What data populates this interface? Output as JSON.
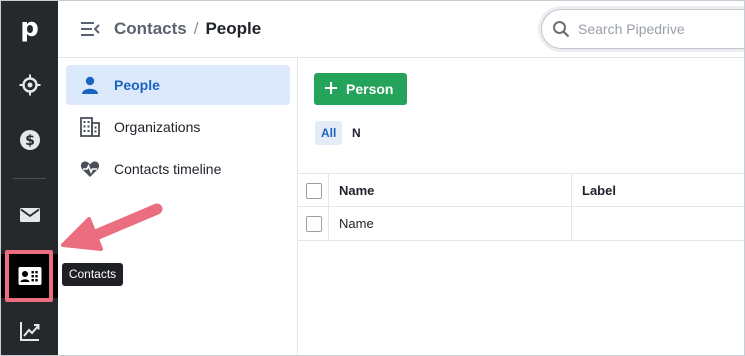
{
  "rail": {
    "logo": "p",
    "items": [
      {
        "icon": "target-icon"
      },
      {
        "icon": "dollar-icon"
      },
      {
        "icon": "mail-icon"
      },
      {
        "icon": "contacts-icon",
        "active": true
      },
      {
        "icon": "chart-trend-icon"
      }
    ],
    "tooltip": "Contacts"
  },
  "header": {
    "breadcrumb_parent": "Contacts",
    "breadcrumb_separator": "/",
    "breadcrumb_current": "People",
    "search_placeholder": "Search Pipedrive"
  },
  "subnav": {
    "items": [
      {
        "label": "People",
        "icon": "person-icon",
        "active": true
      },
      {
        "label": "Organizations",
        "icon": "building-icon"
      },
      {
        "label": "Contacts timeline",
        "icon": "heartbeat-icon"
      }
    ]
  },
  "main": {
    "add_button_label": "Person",
    "filters": [
      "All",
      "N"
    ],
    "table": {
      "columns": [
        "Name",
        "Label"
      ],
      "rows": [
        {
          "name": "Name",
          "label": ""
        }
      ]
    }
  },
  "colors": {
    "rail_bg": "#26292c",
    "accent_blue": "#1a64c2",
    "active_bg": "#dce9fa",
    "add_green": "#26a35a",
    "annotation_pink": "#ea6d80"
  }
}
